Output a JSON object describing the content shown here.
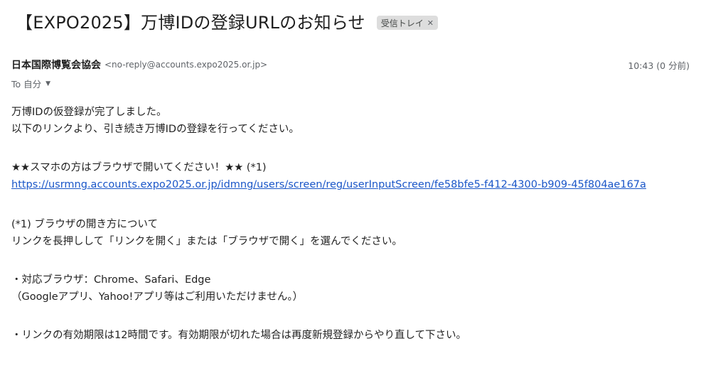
{
  "email": {
    "subject": "【EXPO2025】万博IDの登録URLのお知らせ",
    "label_chip": "受信トレイ",
    "sender_name": "日本国際博覧会協会",
    "sender_email": "<no-reply@accounts.expo2025.or.jp>",
    "timestamp": "10:43 (0 分前)",
    "to_label": "To 自分",
    "body": {
      "line1": "万博IDの仮登録が完了しました。",
      "line2": "以下のリンクより、引き続き万博IDの登録を行ってください。",
      "line3": "★★スマホの方はブラウザで開いてください！★★ (*1)",
      "link": "https://usrmng.accounts.expo2025.or.jp/idmng/users/screen/reg/userInputScreen/fe58bfe5-f412-4300-b909-45f804ae167a",
      "line4": "(*1) ブラウザの開き方について",
      "line5": "リンクを長押しして「リンクを開く」または「ブラウザで開く」を選んでください。",
      "line6": "・対応ブラウザ：Chrome、Safari、Edge",
      "line7": "（Googleアプリ、Yahoo!アプリ等はご利用いただけません。）",
      "line8": "・リンクの有効期限は12時間です。有効期限が切れた場合は再度新規登録からやり直して下さい。"
    }
  },
  "icons": {
    "chip_close": "close-icon",
    "to_dropdown": "chevron-down-icon"
  },
  "colors": {
    "link": "#1a56c8",
    "chip_bg": "#dddddd",
    "muted_text": "#5f6368"
  }
}
